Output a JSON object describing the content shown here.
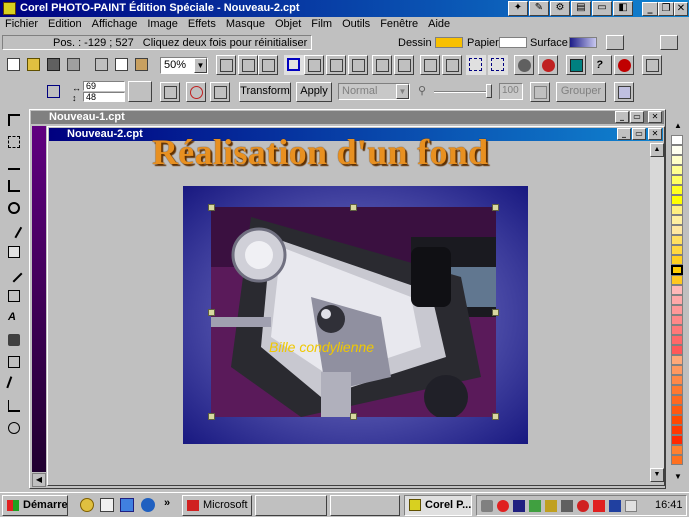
{
  "window": {
    "title": "Corel PHOTO-PAINT Édition Spéciale - Nouveau-2.cpt"
  },
  "menu": [
    "Fichier",
    "Edition",
    "Affichage",
    "Image",
    "Effets",
    "Masque",
    "Objet",
    "Film",
    "Outils",
    "Fenêtre",
    "Aide"
  ],
  "status": {
    "position": "Pos. : -129 ; 527",
    "hint": "Cliquez deux fois pour réinitialiser",
    "dessin_label": "Dessin :",
    "papier_label": "Papier :",
    "surface_label": "Surface :",
    "colors": {
      "dessin": "#f8c000",
      "papier": "#ffffff",
      "surface_start": "#1c1c88",
      "surface_end": "#c8c8f0"
    }
  },
  "toolbar": {
    "zoom": "50%"
  },
  "property_bar": {
    "width_value": "69",
    "height_value": "48",
    "transform_label": "Transform",
    "apply_label": "Apply",
    "merge_mode": "Normal",
    "opacity_value": "100",
    "group_label": "Grouper"
  },
  "documents": {
    "back": {
      "title": "Nouveau-1.cpt"
    },
    "front": {
      "title": "Nouveau-2.cpt"
    }
  },
  "canvas": {
    "heading": "Réalisation d'un fond",
    "photo_caption": "Bille condylienne",
    "colors": {
      "frame_center": "#7878c8",
      "frame_edge": "#141478",
      "heading": "#e89020",
      "caption": "#f0c800"
    }
  },
  "palette": [
    "#ffffff",
    "#fffff0",
    "#ffffc8",
    "#ffff90",
    "#ffff60",
    "#ffff20",
    "#ffff00",
    "#fff080",
    "#fff0a0",
    "#ffe8a0",
    "#ffe060",
    "#ffd840",
    "#ffd020",
    "#ffcc00",
    "#ffc820",
    "#ffb8b8",
    "#ffa8a8",
    "#ff9898",
    "#ff8888",
    "#ff7878",
    "#ff6868",
    "#ff5858",
    "#ffa878",
    "#ff9860",
    "#ff8848",
    "#ff7830",
    "#ff6820",
    "#ff5810",
    "#ff4800",
    "#ff3800",
    "#ff2800",
    "#ff8030",
    "#ff7020"
  ],
  "taskbar": {
    "start_label": "Démarrer",
    "tasks": [
      "Microsoft ...",
      "",
      "",
      "Corel P..."
    ],
    "clock": "16:41"
  }
}
